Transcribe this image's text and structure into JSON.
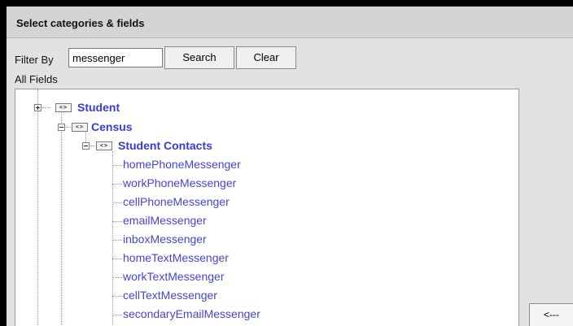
{
  "panel": {
    "title": "Select categories & fields"
  },
  "filter": {
    "label": "Filter By",
    "value": "messenger",
    "search_label": "Search",
    "clear_label": "Clear"
  },
  "tree": {
    "header": "All Fields",
    "categories": [
      {
        "label": "Student",
        "state": "collapsed"
      },
      {
        "label": "Census",
        "state": "expanded"
      },
      {
        "label": "Student Contacts",
        "state": "expanded"
      }
    ],
    "fields": [
      "homePhoneMessenger",
      "workPhoneMessenger",
      "cellPhoneMessenger",
      "emailMessenger",
      "inboxMessenger",
      "homeTextMessenger",
      "workTextMessenger",
      "cellTextMessenger",
      "secondaryEmailMessenger"
    ]
  },
  "side": {
    "remove_label": "<---"
  },
  "colors": {
    "link": "#4444d6",
    "frame": "#000000",
    "panel_bg": "#e2e2e2"
  },
  "icons": {
    "category": "category-icon",
    "expand": "plus-box-icon",
    "collapse": "minus-box-icon"
  }
}
